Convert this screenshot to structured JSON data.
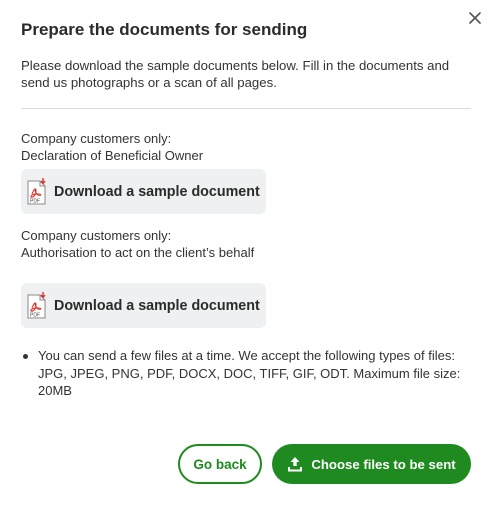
{
  "dialog": {
    "title": "Prepare the documents for sending",
    "intro": "Please download the sample documents below. Fill in the documents and send us photographs or a scan of all pages.",
    "close_icon": "close-icon"
  },
  "documents": [
    {
      "label_line1": "Company customers only:",
      "label_line2": "Declaration of Beneficial Owner",
      "button_label": "Download a sample document",
      "icon": "pdf-download-icon"
    },
    {
      "label_line1": "Company customers only:",
      "label_line2": "Authorisation to act on the client’s behalf",
      "button_label": "Download a sample document",
      "icon": "pdf-download-icon"
    }
  ],
  "info": {
    "items": [
      "You can send a few files at a time. We accept the following types of files: JPG, JPEG, PNG, PDF, DOCX, DOC, TIFF, GIF, ODT. Maximum file size: 20MB"
    ]
  },
  "footer": {
    "back_label": "Go back",
    "send_label": "Choose files to be sent",
    "send_icon": "upload-icon"
  },
  "colors": {
    "accent": "#1f8a1f",
    "button_bg": "#eef0f1",
    "pdf_red": "#d9342b"
  }
}
